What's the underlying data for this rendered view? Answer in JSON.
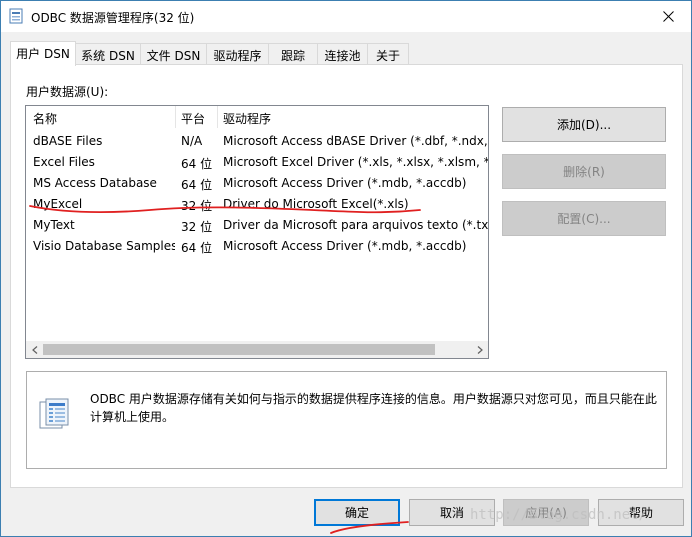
{
  "window": {
    "title": "ODBC 数据源管理程序(32 位)",
    "close_glyph": "✕"
  },
  "tabs": [
    {
      "label": "用户 DSN",
      "active": true
    },
    {
      "label": "系统 DSN"
    },
    {
      "label": "文件 DSN"
    },
    {
      "label": "驱动程序"
    },
    {
      "label": "跟踪"
    },
    {
      "label": "连接池"
    },
    {
      "label": "关于"
    }
  ],
  "panel": {
    "section_label": "用户数据源(U):",
    "columns": [
      "名称",
      "平台",
      "驱动程序"
    ],
    "rows": [
      [
        "dBASE Files",
        "N/A",
        "Microsoft Access dBASE Driver (*.dbf, *.ndx, *"
      ],
      [
        "Excel Files",
        "64 位",
        "Microsoft Excel Driver (*.xls, *.xlsx, *.xlsm, *.xls"
      ],
      [
        "MS Access Database",
        "64 位",
        "Microsoft Access Driver (*.mdb, *.accdb)"
      ],
      [
        "MyExcel",
        "32 位",
        "Driver do Microsoft Excel(*.xls)"
      ],
      [
        "MyText",
        "32 位",
        "Driver da Microsoft para arquivos texto (*.txt;"
      ],
      [
        "Visio Database Samples",
        "64 位",
        "Microsoft Access Driver (*.mdb, *.accdb)"
      ]
    ],
    "buttons": {
      "add": "添加(D)...",
      "remove": "删除(R)",
      "configure": "配置(C)..."
    },
    "info": "ODBC 用户数据源存储有关如何与指示的数据提供程序连接的信息。用户数据源只对您可见，而且只能在此计算机上使用。"
  },
  "footer": {
    "ok": "确定",
    "cancel": "取消",
    "apply": "应用(A)",
    "help": "帮助"
  },
  "watermark": "http://blog.csdn.net/",
  "colors": {
    "accent": "#0078d7",
    "annotation_red": "#e02020"
  },
  "icons": {
    "title": "odbc-app-icon",
    "info": "data-source-icon",
    "close": "close-icon"
  }
}
